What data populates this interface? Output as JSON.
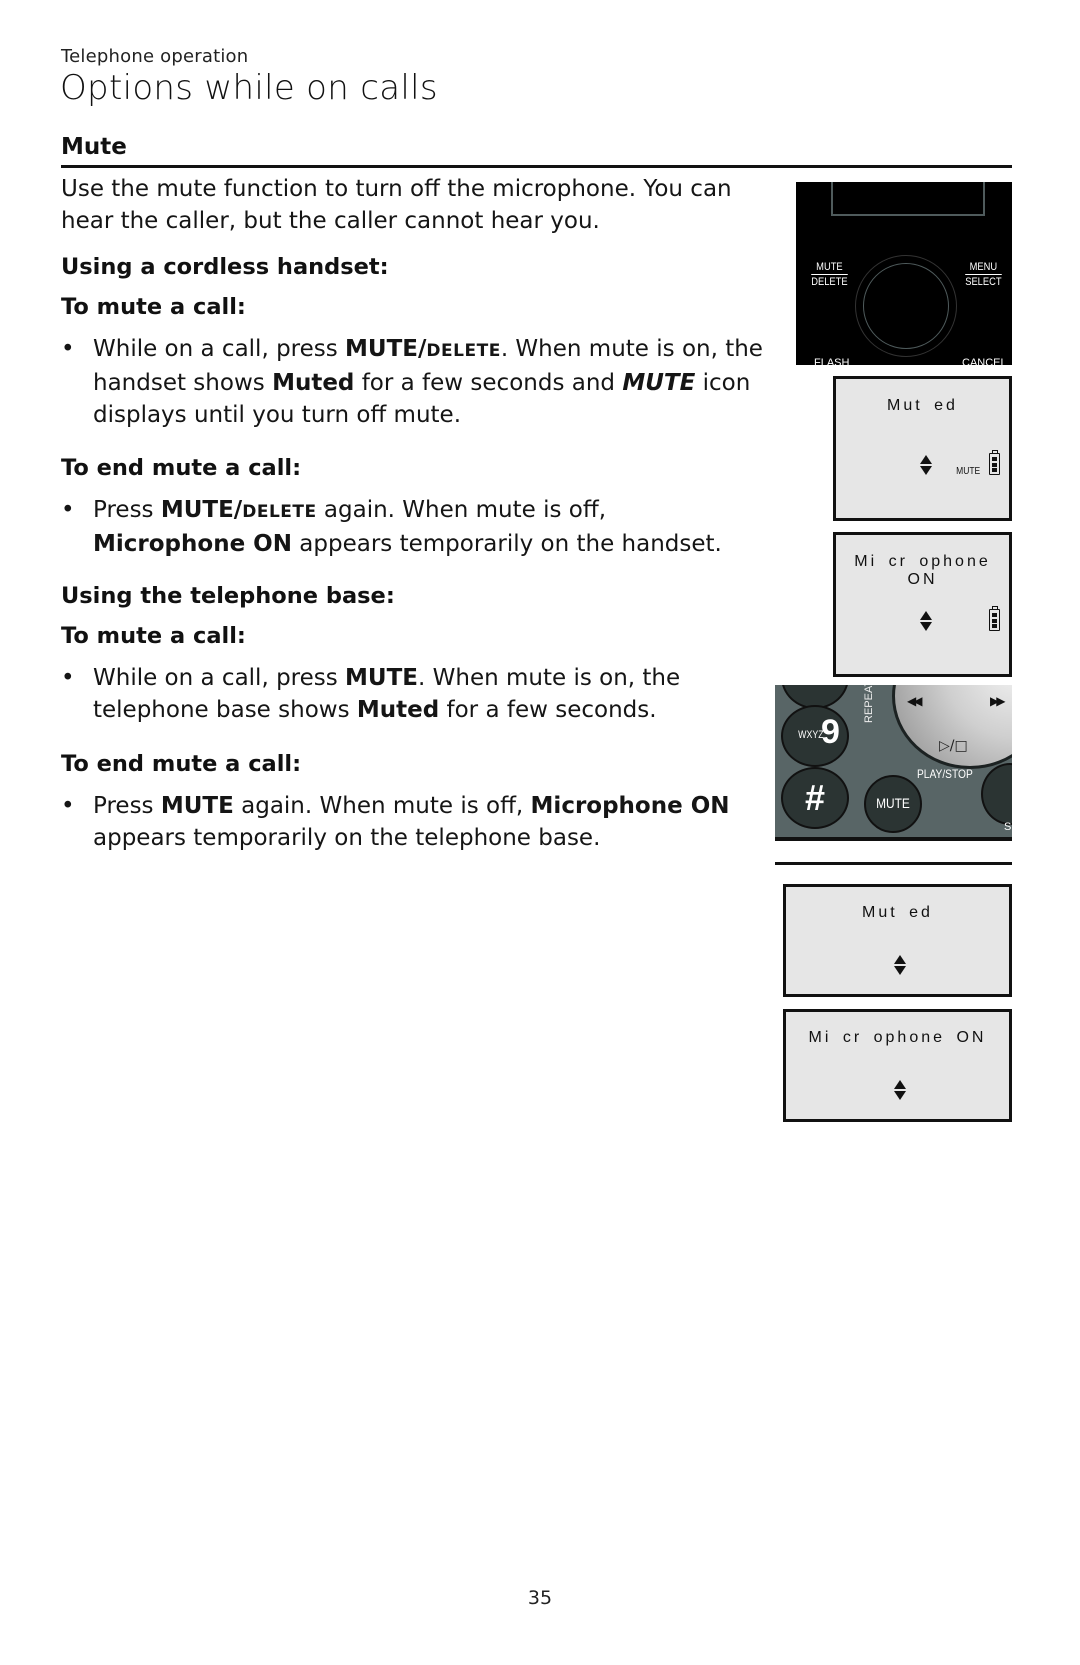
{
  "header": {
    "section": "Telephone operation",
    "title": "Options while on calls"
  },
  "mute": {
    "heading": "Mute",
    "intro": "Use the mute function to turn off the microphone. You can hear the caller, but the caller cannot hear you.",
    "handset": {
      "heading": "Using a cordless handset:",
      "mute_heading": "To mute a call:",
      "mute_bullet": {
        "p1": "While on a call, press ",
        "key1": "MUTE/",
        "key1_sc": "DELETE",
        "p2": ". When mute is on, the handset shows ",
        "b1": "Muted",
        "p3": " for a few seconds and ",
        "b2": "MUTE",
        "p4": " icon displays until you turn off mute."
      },
      "end_heading": "To end mute a call:",
      "end_bullet": {
        "p1": "Press ",
        "key1": "MUTE/",
        "key1_sc": "DELETE",
        "p2": " again. When mute is off, ",
        "b1": "Microphone ON",
        "p3": " appears temporarily on the handset."
      }
    },
    "base": {
      "heading": "Using the telephone base:",
      "mute_heading": "To mute a call:",
      "mute_bullet": {
        "p1": "While on a call, press ",
        "key1": "MUTE",
        "p2": ". When mute is on, the telephone base shows ",
        "b1": "Muted",
        "p3": " for a few seconds."
      },
      "end_heading": "To end mute a call:",
      "end_bullet": {
        "p1": "Press ",
        "key1": "MUTE",
        "p2": " again. When mute is off, ",
        "b1": "Microphone ON",
        "p3": " appears temporarily on the telephone base."
      }
    }
  },
  "illustrations": {
    "handset_keys": {
      "mute_top": "MUTE",
      "mute_bottom": "DELETE",
      "menu_top": "MENU",
      "menu_bottom": "SELECT",
      "flash": "FLASH",
      "cancel": "CANCEL"
    },
    "handset_screens": [
      {
        "text": "Mut ed",
        "indicator": "MUTE"
      },
      {
        "text": "Mi cr ophone  ON"
      }
    ],
    "base_keys": {
      "nine_letters": "WXYZ",
      "nine": "9",
      "hash": "#",
      "mute": "MUTE",
      "repeat": "REPEAT",
      "play_stop": "PLAY/STOP",
      "play_symbol": "▷/□",
      "rewind": "◀◀",
      "forward": "▶▶",
      "partial": "S"
    },
    "base_screens": [
      {
        "text": "Mut ed"
      },
      {
        "text": "Mi cr ophone  ON"
      }
    ]
  },
  "footer": {
    "page_number": "35"
  }
}
